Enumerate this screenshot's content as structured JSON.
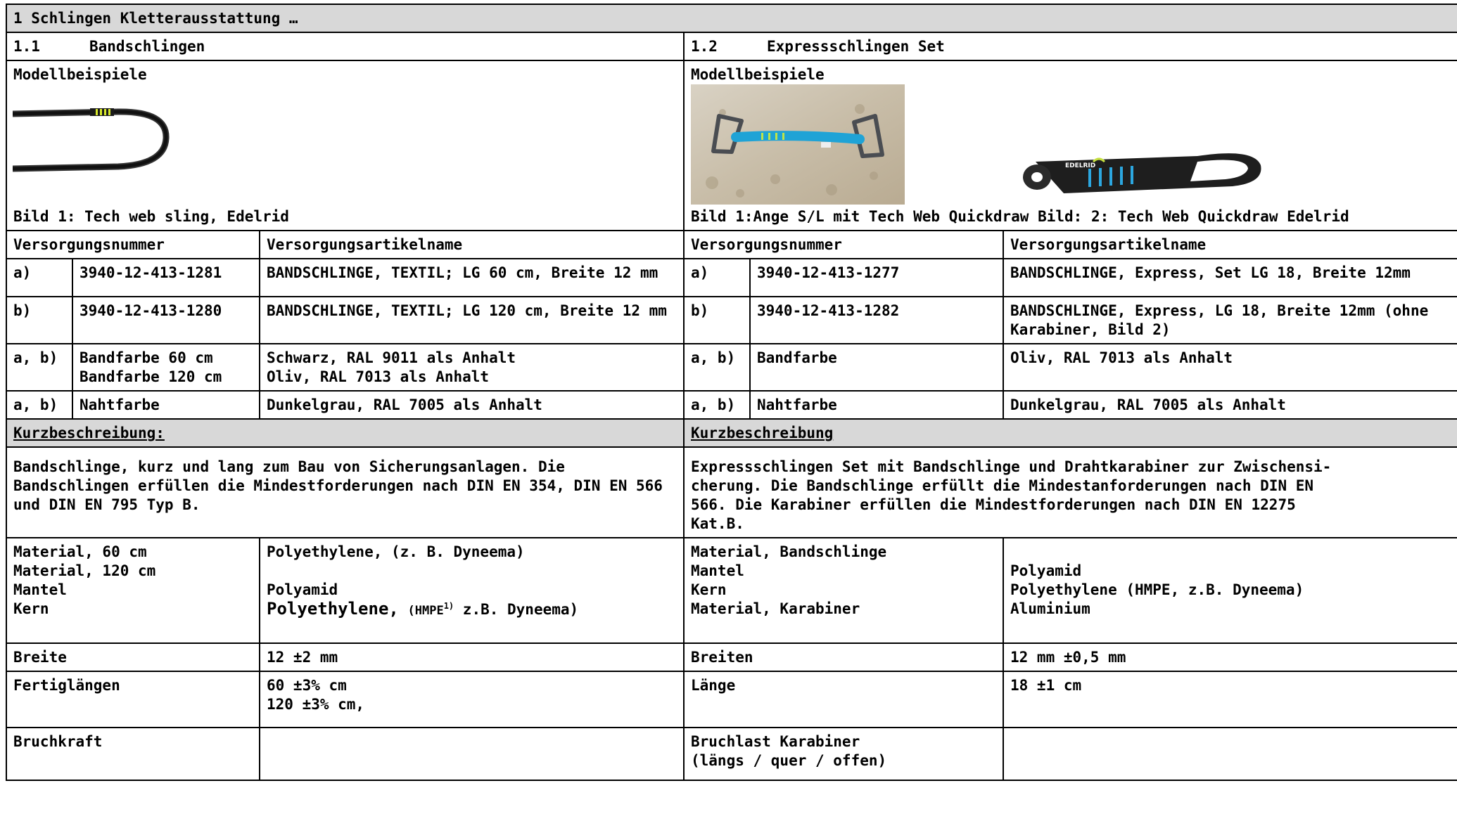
{
  "title": "1 Schlingen Kletterausstattung …",
  "left": {
    "number": "1.1",
    "heading": "Bandschlingen",
    "examples_label": "Modellbeispiele",
    "caption": "Bild 1: Tech web sling, Edelrid",
    "header_nr": "Versorgungsnummer",
    "header_name": "Versorgungsartikelname",
    "rows": [
      {
        "key": "a)",
        "nr": "3940-12-413-1281",
        "name": "BANDSCHLINGE, TEXTIL; LG 60 cm, Breite 12 mm"
      },
      {
        "key": "b)",
        "nr": "3940-12-413-1280",
        "name": "BANDSCHLINGE, TEXTIL; LG 120 cm, Breite 12 mm"
      }
    ],
    "color_key": "a, b)",
    "color_label_1": "Bandfarbe 60 cm",
    "color_label_2": "Bandfarbe 120 cm",
    "color_value_1": "Schwarz, RAL 9011 als Anhalt",
    "color_value_2": "Oliv, RAL 7013 als Anhalt",
    "seam_key": "a, b)",
    "seam_label": "Nahtfarbe",
    "seam_value": "Dunkelgrau, RAL 7005 als Anhalt",
    "desc_label": "Kurzbeschreibung:",
    "desc_text": "Bandschlinge, kurz und lang zum Bau von Sicherungsanlagen. Die Bandschlingen erfüllen die Mindestforderungen nach DIN EN 354, DIN EN 566 und DIN EN 795 Typ B.",
    "mat_label_1": "Material, 60 cm",
    "mat_label_2": "Material, 120 cm",
    "mat_label_3": "Mantel",
    "mat_label_4": "Kern",
    "mat_value_1": "Polyethylene,  (z. B. Dyneema)",
    "mat_value_2": "Polyamid",
    "mat_value_3a": "Polyethylene,",
    "mat_value_3b": "(HMPE",
    "mat_value_3sup": "1)",
    "mat_value_3c": "z.B. Dyneema)",
    "width_label": "Breite",
    "width_value": "12 ±2 mm",
    "length_label": "Fertiglängen",
    "length_value_1": "60 ±3% cm",
    "length_value_2": "120 ±3% cm,",
    "force_label": "Bruchkraft"
  },
  "right": {
    "number": "1.2",
    "heading": "Expressschlingen Set",
    "examples_label": "Modellbeispiele",
    "caption_1": "Bild 1:Ange S/L mit Tech Web Quickdraw",
    "caption_2": "Bild: 2: Tech Web Quickdraw Edelrid",
    "logo_text": "EDELRID",
    "header_nr": "Versorgungsnummer",
    "header_name": "Versorgungsartikelname",
    "rows": [
      {
        "key": "a)",
        "nr": "3940-12-413-1277",
        "name": "BANDSCHLINGE, Express, Set LG 18, Breite 12mm"
      },
      {
        "key": "b)",
        "nr": "3940-12-413-1282",
        "name": "BANDSCHLINGE, Express, LG 18, Breite 12mm (ohne Karabiner, Bild 2)"
      }
    ],
    "color_key": "a, b)",
    "color_label": "Bandfarbe",
    "color_value": "Oliv, RAL 7013 als Anhalt",
    "seam_key": "a, b)",
    "seam_label": "Nahtfarbe",
    "seam_value": "Dunkelgrau, RAL 7005 als Anhalt",
    "desc_label": "Kurzbeschreibung",
    "desc_line_1": "Expressschlingen Set mit Bandschlinge und Drahtkarabiner zur Zwischensi-",
    "desc_line_2": "cherung. Die Bandschlinge erfüllt die Mindestanforderungen nach DIN EN",
    "desc_line_3": "566. Die Karabiner erfüllen die Mindestforderungen nach DIN EN 12275",
    "desc_line_4": "Kat.B.",
    "mat_label_1": "Material, Bandschlinge",
    "mat_label_2": "Mantel",
    "mat_label_3": "Kern",
    "mat_label_4": "Material, Karabiner",
    "mat_value_1": "Polyamid",
    "mat_value_2": "Polyethylene (HMPE, z.B. Dyneema)",
    "mat_value_3": "Aluminium",
    "width_label": "Breiten",
    "width_value": "12 mm ±0,5 mm",
    "length_label": "Länge",
    "length_value": "18 ±1 cm",
    "force_label_1": "Bruchlast Karabiner",
    "force_label_2": "(längs / quer / offen)"
  }
}
